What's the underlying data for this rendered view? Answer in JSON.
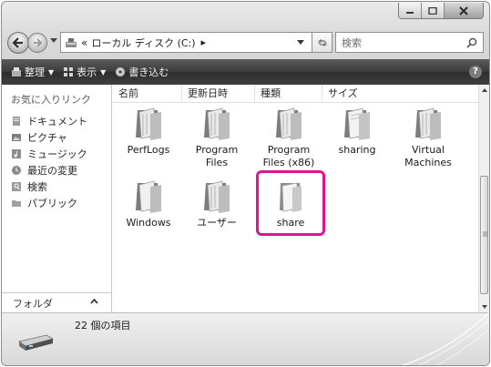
{
  "window": {
    "caption_buttons": [
      {
        "name": "minimize-button",
        "icon": "minimize-icon"
      },
      {
        "name": "maximize-button",
        "icon": "maximize-icon"
      },
      {
        "name": "close-button",
        "icon": "close-icon"
      }
    ]
  },
  "address_bar": {
    "overflow": "«",
    "location": "ローカル ディスク (C:)",
    "location_arrow": "▸"
  },
  "search": {
    "placeholder": "検索"
  },
  "toolbar": {
    "organize_label": "整理",
    "views_label": "表示",
    "burn_label": "書き込む",
    "help_label": "?"
  },
  "navigation": {
    "favorites_header": "お気に入りリンク",
    "items": [
      {
        "label": "ドキュメント",
        "icon": "documents-icon"
      },
      {
        "label": "ピクチャ",
        "icon": "pictures-icon"
      },
      {
        "label": "ミュージック",
        "icon": "music-icon"
      },
      {
        "label": "最近の変更",
        "icon": "recent-changes-icon"
      },
      {
        "label": "検索",
        "icon": "searches-icon"
      },
      {
        "label": "パブリック",
        "icon": "public-icon"
      }
    ],
    "folders_label": "フォルダ",
    "folders_toggle": "^"
  },
  "columns": [
    "名前",
    "更新日時",
    "種類",
    "サイズ"
  ],
  "files": [
    {
      "label": "PerfLogs",
      "icon": "folder-icon"
    },
    {
      "label": "Program Files",
      "icon": "folder-icon"
    },
    {
      "label": "Program Files (x86)",
      "icon": "folder-icon"
    },
    {
      "label": "sharing",
      "icon": "folder-icon"
    },
    {
      "label": "Virtual Machines",
      "icon": "folder-icon"
    },
    {
      "label": "Windows",
      "icon": "folder-icon"
    },
    {
      "label": "ユーザー",
      "icon": "folder-icon"
    },
    {
      "label": "share",
      "icon": "folder-icon",
      "highlighted": true
    }
  ],
  "details": {
    "item_count": "22 個の項目",
    "icon": "drive-icon"
  },
  "colors": {
    "highlight": "#e0148e",
    "toolbar_bg": "#3b3b3b"
  }
}
